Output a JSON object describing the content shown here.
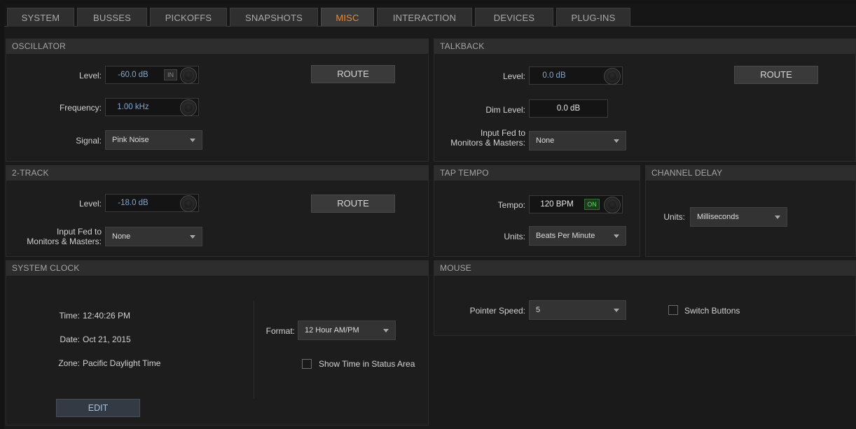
{
  "tabs": [
    {
      "label": "SYSTEM",
      "active": false
    },
    {
      "label": "BUSSES",
      "active": false
    },
    {
      "label": "PICKOFFS",
      "active": false
    },
    {
      "label": "SNAPSHOTS",
      "active": false
    },
    {
      "label": "MISC",
      "active": true
    },
    {
      "label": "INTERACTION",
      "active": false
    },
    {
      "label": "DEVICES",
      "active": false
    },
    {
      "label": "PLUG-INS",
      "active": false
    }
  ],
  "oscillator": {
    "title": "OSCILLATOR",
    "level_label": "Level:",
    "level_value": "-60.0 dB",
    "in_label": "IN",
    "frequency_label": "Frequency:",
    "frequency_value": "1.00 kHz",
    "signal_label": "Signal:",
    "signal_value": "Pink Noise",
    "route_label": "ROUTE"
  },
  "talkback": {
    "title": "TALKBACK",
    "level_label": "Level:",
    "level_value": "0.0 dB",
    "dim_label": "Dim Level:",
    "dim_value": "0.0 dB",
    "input_label_1": "Input Fed to",
    "input_label_2": "Monitors & Masters:",
    "input_value": "None",
    "route_label": "ROUTE"
  },
  "two_track": {
    "title": "2-TRACK",
    "level_label": "Level:",
    "level_value": "-18.0 dB",
    "input_label_1": "Input Fed to",
    "input_label_2": "Monitors & Masters:",
    "input_value": "None",
    "route_label": "ROUTE"
  },
  "tap_tempo": {
    "title": "TAP TEMPO",
    "tempo_label": "Tempo:",
    "tempo_value": "120 BPM",
    "on_label": "ON",
    "units_label": "Units:",
    "units_value": "Beats Per Minute"
  },
  "channel_delay": {
    "title": "CHANNEL DELAY",
    "units_label": "Units:",
    "units_value": "Milliseconds"
  },
  "system_clock": {
    "title": "SYSTEM CLOCK",
    "time_label": "Time:",
    "time_value": "12:40:26 PM",
    "date_label": "Date:",
    "date_value": "Oct 21, 2015",
    "zone_label": "Zone:",
    "zone_value": "Pacific Daylight Time",
    "format_label": "Format:",
    "format_value": "12 Hour AM/PM",
    "show_time_label": "Show Time in Status Area",
    "show_time_checked": false,
    "edit_label": "EDIT"
  },
  "mouse": {
    "title": "MOUSE",
    "pointer_label": "Pointer Speed:",
    "pointer_value": "5",
    "switch_label": "Switch Buttons",
    "switch_checked": false
  },
  "colors": {
    "active_tab": "#e8893a",
    "value_blue": "#7fa7cf",
    "on_green": "#5fdc5f"
  }
}
